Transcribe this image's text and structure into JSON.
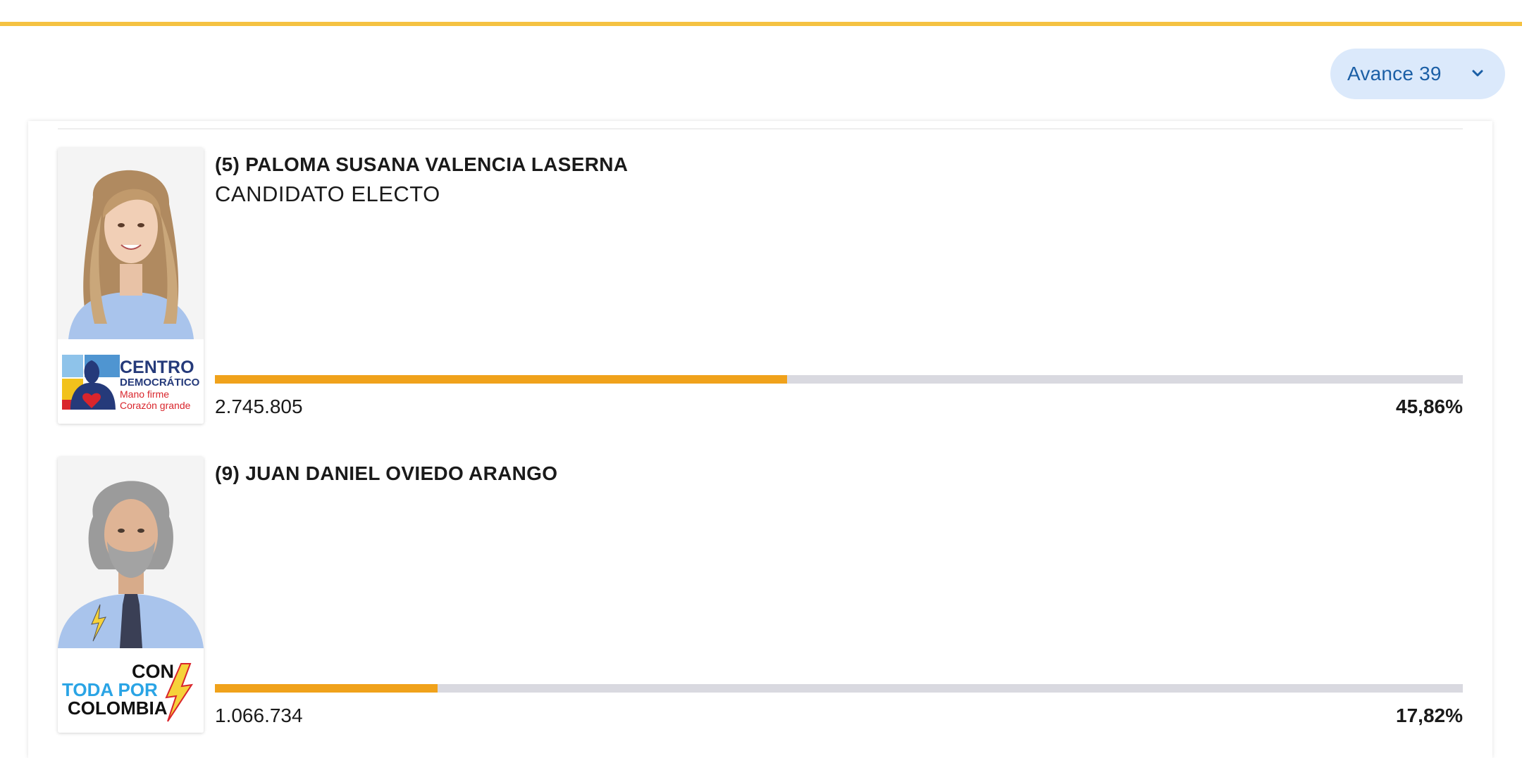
{
  "avance": {
    "label": "Avance 39"
  },
  "candidates": [
    {
      "name": "(5) PALOMA SUSANA VALENCIA LASERNA",
      "status": "CANDIDATO ELECTO",
      "votes": "2.745.805",
      "percent": "45,86%",
      "share": 0.4586,
      "party_logo_text": [
        "CENTRO",
        "DEMOCRÁTICO",
        "Mano firme",
        "Corazón grande"
      ]
    },
    {
      "name": "(9) JUAN DANIEL OVIEDO ARANGO",
      "status": "",
      "votes": "1.066.734",
      "percent": "17,82%",
      "share": 0.1782,
      "party_logo_text": [
        "CON",
        "TODA POR",
        "COLOMBIA"
      ]
    }
  ],
  "colors": {
    "accent_bar": "#f5c242",
    "progress_fill": "#f0a21b",
    "progress_track": "#d9d9e0",
    "select_bg": "#dbe9fb",
    "select_text": "#1b5fa6"
  },
  "icons": {
    "select": "chevron-down-icon"
  }
}
